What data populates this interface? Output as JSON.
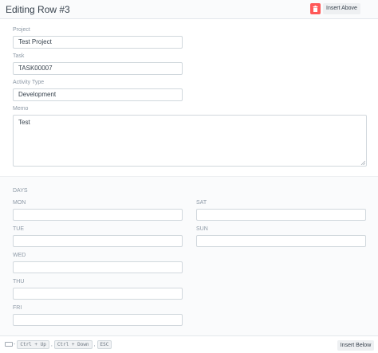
{
  "header": {
    "title": "Editing Row #3",
    "insert_above_label": "Insert Above",
    "delete_icon": "trash-icon"
  },
  "fields": {
    "project": {
      "label": "Project",
      "value": "Test Project"
    },
    "task": {
      "label": "Task",
      "value": "TASK00007"
    },
    "activity_type": {
      "label": "Activity Type",
      "value": "Development"
    },
    "memo": {
      "label": "Memo",
      "value": "Test"
    }
  },
  "days": {
    "section_label": "DAYS",
    "mon": {
      "label": "MON",
      "value": ""
    },
    "tue": {
      "label": "TUE",
      "value": ""
    },
    "wed": {
      "label": "WED",
      "value": ""
    },
    "thu": {
      "label": "THU",
      "value": ""
    },
    "fri": {
      "label": "FRI",
      "value": ""
    },
    "sat": {
      "label": "SAT",
      "value": ""
    },
    "sun": {
      "label": "SUN",
      "value": ""
    }
  },
  "footer": {
    "dash": "-",
    "shortcut_1": "Ctrl + Up",
    "shortcut_2": "Ctrl + Down",
    "shortcut_3": "ESC",
    "separator": ",",
    "insert_below_label": "Insert Below",
    "keyboard_icon": "keyboard-icon"
  },
  "colors": {
    "delete": "#ff5858",
    "label": "#8d99a6",
    "border": "#d1d8dd",
    "section_bg": "#fafbfc"
  }
}
